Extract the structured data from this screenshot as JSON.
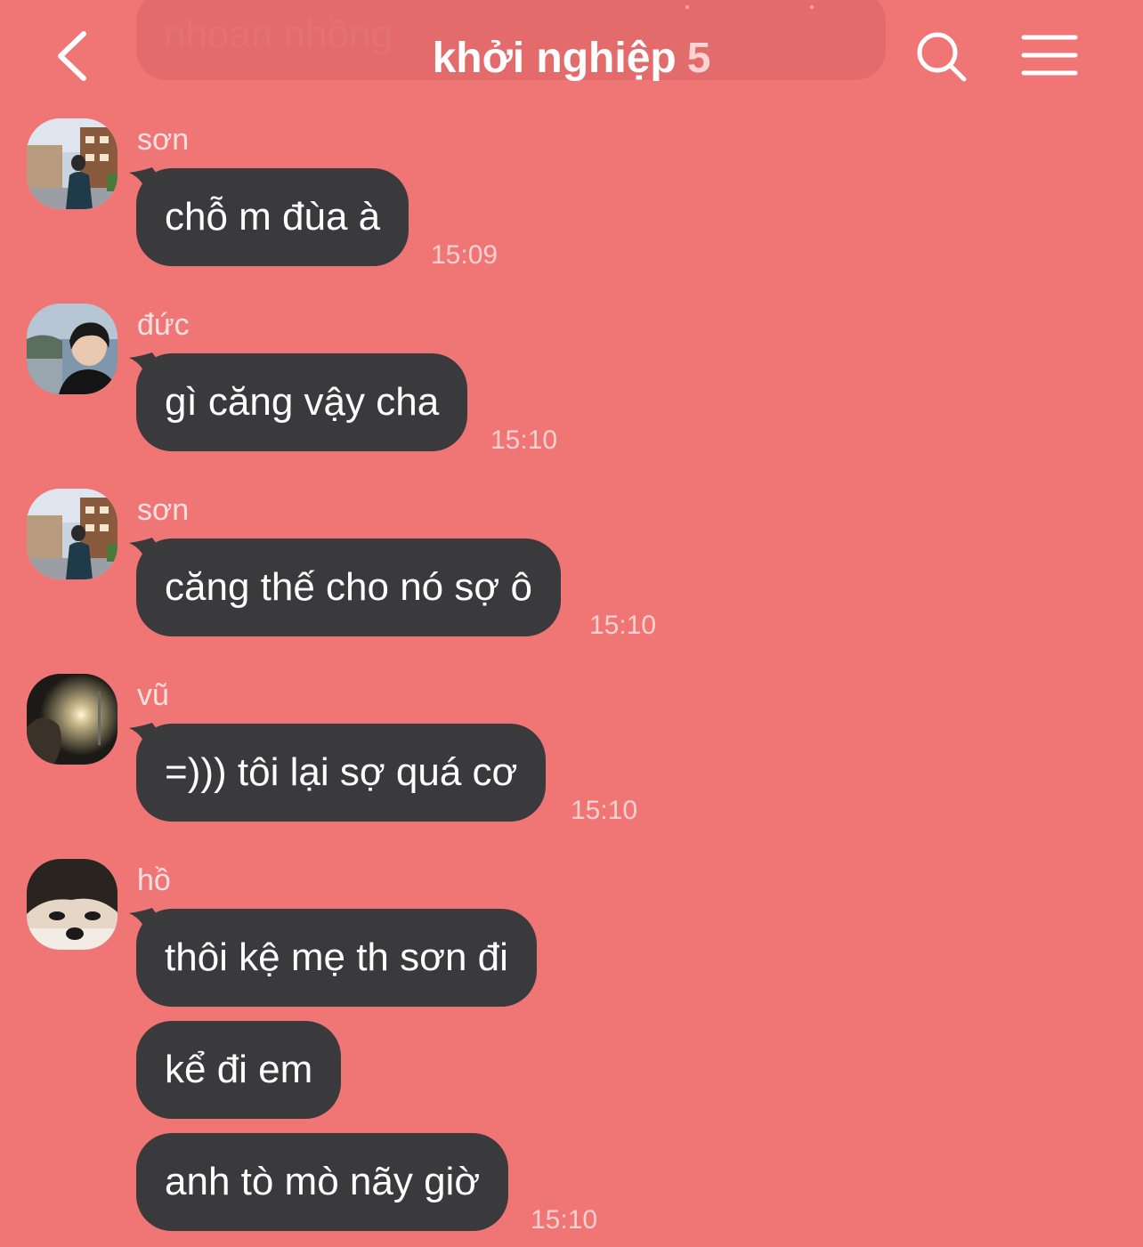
{
  "header": {
    "title": "khởi nghiệp",
    "member_count": "5",
    "pinned_preview": "nhoan nhồng",
    "icons": {
      "back": "chevron-left-icon",
      "search": "search-icon",
      "menu": "hamburger-menu-icon"
    }
  },
  "messages": [
    {
      "sender": "sơn",
      "text": "chỗ m đùa à",
      "time": "15:09"
    },
    {
      "sender": "đức",
      "text": "gì căng vậy cha",
      "time": "15:10"
    },
    {
      "sender": "sơn",
      "text": "căng thế cho nó sợ ô",
      "time": "15:10"
    },
    {
      "sender": "vũ",
      "text": "=))) tôi lại sợ quá cơ",
      "time": "15:10"
    },
    {
      "sender": "hồ",
      "text": "thôi kệ mẹ th sơn đi"
    },
    {
      "text": "kể đi em"
    },
    {
      "text": "anh tò mò nãy giờ",
      "time": "15:10"
    }
  ],
  "colors": {
    "background": "#f07676",
    "bubble": "#3a3a3c",
    "text_primary": "#ffffff",
    "text_secondary": "#fbd0d0"
  }
}
